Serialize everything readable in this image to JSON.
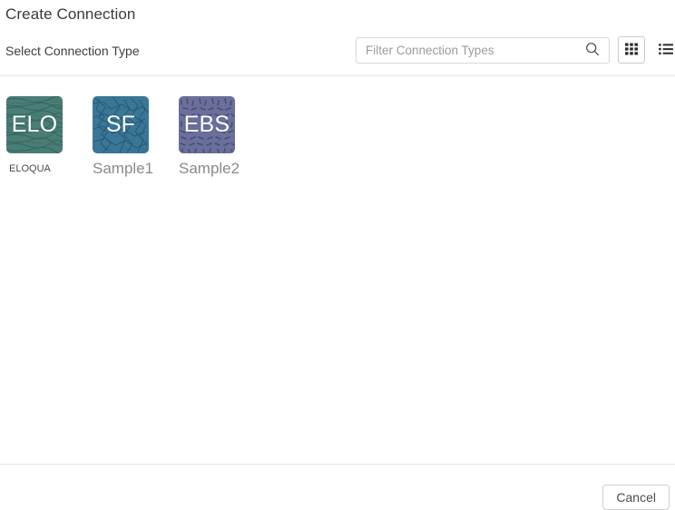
{
  "dialog": {
    "title": "Create Connection"
  },
  "toolbar": {
    "label": "Select Connection Type",
    "search": {
      "placeholder": "Filter Connection Types",
      "value": "",
      "icon": "search-icon"
    },
    "views": [
      {
        "id": "grid",
        "icon": "grid-view-icon",
        "selected": true
      },
      {
        "id": "list",
        "icon": "list-view-icon",
        "selected": false
      }
    ]
  },
  "connection_types": [
    {
      "abbr": "ELO",
      "label": "ELOQUA",
      "label_style": "small",
      "color": "#4b7d77",
      "texture": "wavy-lines",
      "texture_color": "#2f5f5a"
    },
    {
      "abbr": "SF",
      "label": "Sample1",
      "label_style": "large",
      "color": "#3a7797",
      "texture": "crackle-shards",
      "texture_color": "#24536c"
    },
    {
      "abbr": "EBS",
      "label": "Sample2",
      "label_style": "large",
      "color": "#6a6f9b",
      "texture": "dashes",
      "texture_color": "#43486f"
    }
  ],
  "footer": {
    "cancel_label": "Cancel"
  },
  "colors": {
    "divider": "#e4e4e4",
    "text_primary": "#3b3b3b",
    "text_muted": "#8a8a8a",
    "placeholder": "#9b9b9b",
    "border": "#d6d7d9"
  }
}
